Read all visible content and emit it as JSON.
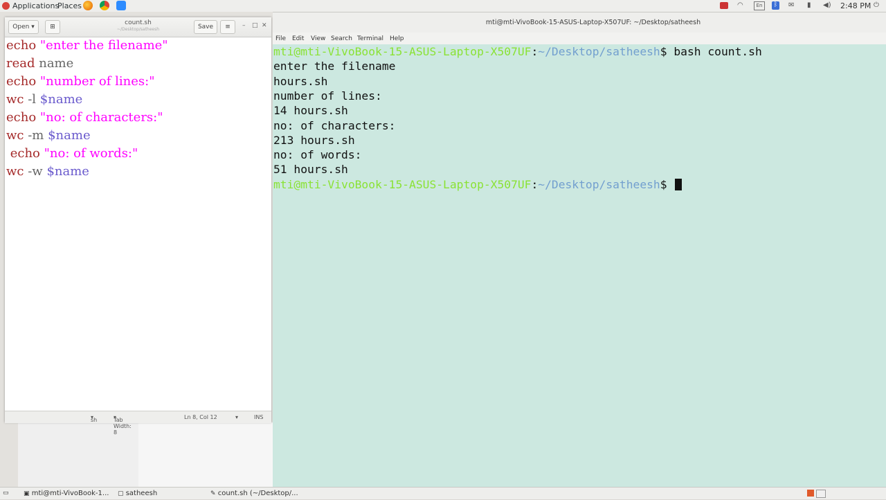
{
  "top_panel": {
    "applications": "Applications",
    "places": "Places",
    "time": "2:48 PM",
    "keyboard": "En",
    "apps": [
      "firefox-icon",
      "chrome-icon",
      "zoom-icon"
    ],
    "tray_icons": [
      "record-icon",
      "wifi-icon",
      "keyboard-icon",
      "bluetooth-icon",
      "mail-icon",
      "battery-icon",
      "volume-icon",
      "power-icon"
    ]
  },
  "gedit": {
    "open_label": "Open",
    "save_label": "Save",
    "title": "count.sh",
    "subtitle": "~/Desktop/satheesh",
    "lines": [
      {
        "parts": [
          {
            "t": "echo ",
            "c": "kw"
          },
          {
            "t": "\"enter the filename\"",
            "c": "str"
          }
        ]
      },
      {
        "parts": [
          {
            "t": "read ",
            "c": "kw"
          },
          {
            "t": "name",
            "c": "plain"
          }
        ]
      },
      {
        "parts": [
          {
            "t": "echo ",
            "c": "kw"
          },
          {
            "t": "\"number of lines:\"",
            "c": "str"
          }
        ]
      },
      {
        "parts": [
          {
            "t": "wc",
            "c": "kw"
          },
          {
            "t": " -l ",
            "c": "plain"
          },
          {
            "t": "$name",
            "c": "var"
          }
        ]
      },
      {
        "parts": [
          {
            "t": "echo ",
            "c": "kw"
          },
          {
            "t": "\"no: of characters:\"",
            "c": "str"
          }
        ]
      },
      {
        "parts": [
          {
            "t": "wc",
            "c": "kw"
          },
          {
            "t": " -m ",
            "c": "plain"
          },
          {
            "t": "$name",
            "c": "var"
          }
        ]
      },
      {
        "parts": [
          {
            "t": " echo ",
            "c": "kw"
          },
          {
            "t": "\"no: of words:\"",
            "c": "str"
          }
        ]
      },
      {
        "parts": [
          {
            "t": "wc",
            "c": "kw"
          },
          {
            "t": " -w ",
            "c": "plain"
          },
          {
            "t": "$name",
            "c": "var"
          }
        ]
      }
    ],
    "status": {
      "language": "sh",
      "tab_width": "Tab Width: 8",
      "position": "Ln 8, Col 12",
      "mode": "INS"
    }
  },
  "terminal": {
    "title": "mti@mti-VivoBook-15-ASUS-Laptop-X507UF: ~/Desktop/satheesh",
    "menu": [
      "File",
      "Edit",
      "View",
      "Search",
      "Terminal",
      "Help"
    ],
    "prompt_user": "mti@mti-VivoBook-15-ASUS-Laptop-X507UF",
    "prompt_colon": ":",
    "prompt_path": "~/Desktop/satheesh",
    "prompt_symbol": "$ ",
    "command": "bash count.sh",
    "output": [
      "enter the filename",
      "hours.sh",
      "number of lines:",
      "14 hours.sh",
      "no: of characters:",
      "213 hours.sh",
      "no: of words:",
      "51 hours.sh"
    ]
  },
  "taskbar": {
    "items": [
      "mti@mti-VivoBook-1...",
      "satheesh",
      "count.sh (~/Desktop/..."
    ]
  }
}
